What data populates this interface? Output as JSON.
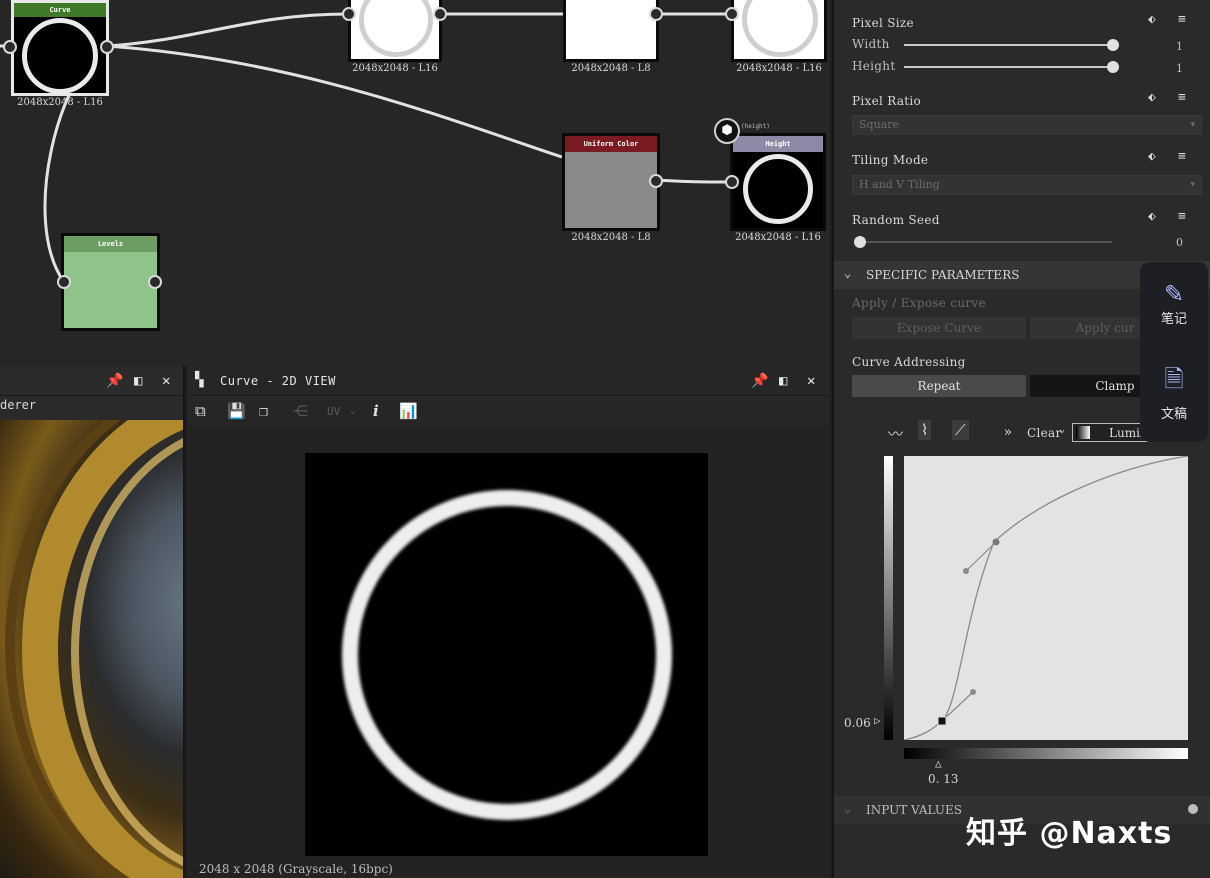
{
  "graph": {
    "nodes": [
      {
        "id": "curve",
        "title": "Curve",
        "caption": "2048x2048 - L16",
        "header_color": "#3f7a2a"
      },
      {
        "id": "n2",
        "title": "",
        "caption": "2048x2048 - L16"
      },
      {
        "id": "n3",
        "title": "",
        "caption": "2048x2048 - L8"
      },
      {
        "id": "n4",
        "title": "",
        "caption": "2048x2048 - L16"
      },
      {
        "id": "uniform",
        "title": "Uniform Color",
        "caption": "2048x2048 - L8",
        "header_color": "#7a1b24"
      },
      {
        "id": "height",
        "title": "Height",
        "caption": "2048x2048 - L16",
        "header_color": "#8d8aa8",
        "badge": "(height)"
      },
      {
        "id": "levels",
        "title": "Levels",
        "caption": "",
        "header_color": "#6e9d62"
      }
    ]
  },
  "left_panel": {
    "label": "derer"
  },
  "view2d": {
    "title": "Curve - 2D VIEW",
    "toolbar_uv": "UV",
    "status": "2048 x 2048 (Grayscale, 16bpc)"
  },
  "props": {
    "pixel_size": {
      "label": "Pixel Size",
      "width_label": "Width",
      "height_label": "Height",
      "width_value": "1",
      "height_value": "1",
      "width_fraction": 1.0,
      "height_fraction": 1.0
    },
    "pixel_ratio": {
      "label": "Pixel Ratio",
      "value": "Square"
    },
    "tiling_mode": {
      "label": "Tiling Mode",
      "value": "H and V Tiling"
    },
    "random_seed": {
      "label": "Random Seed",
      "value": "0",
      "fraction": 0.0
    },
    "specific_section": "SPECIFIC PARAMETERS",
    "apply_expose_label": "Apply / Expose curve",
    "expose_button": "Expose Curve",
    "apply_button": "Apply cur",
    "curve_addressing_label": "Curve Addressing",
    "repeat_button": "Repeat",
    "clamp_button": "Clamp",
    "clear_label": "Clear",
    "channel_label": "Lumin",
    "y_value": "0.06",
    "x_value": "0. 13",
    "input_section": "INPUT VALUES"
  },
  "side_widget": {
    "notes": "笔记",
    "draft": "文稿"
  },
  "watermark": "知乎 @Naxts"
}
